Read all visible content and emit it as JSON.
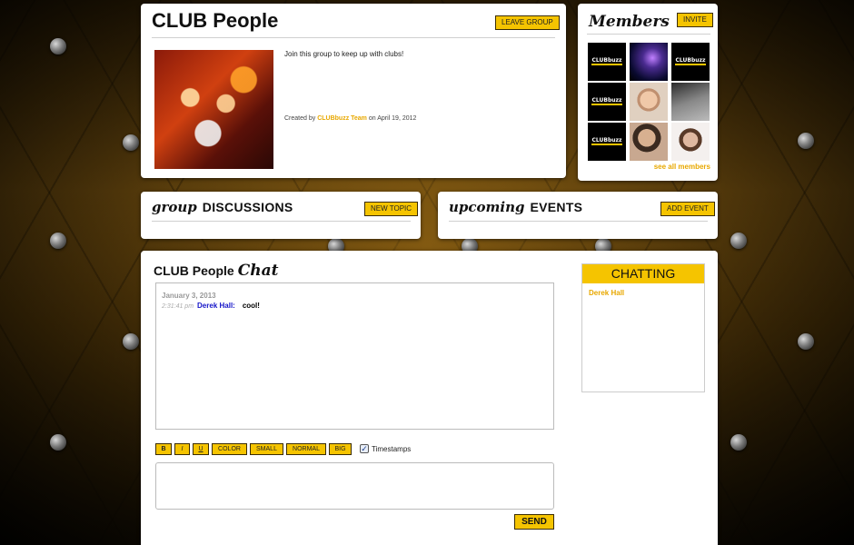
{
  "group": {
    "title": "CLUB People",
    "leave_label": "LEAVE GROUP",
    "description": "Join this group to keep up with clubs!",
    "created_prefix": "Created by",
    "created_by": "CLUBbuzz Team",
    "created_suffix": "on April 19, 2012"
  },
  "members": {
    "title": "Members",
    "invite_label": "INVITE",
    "see_all_label": "see all members",
    "logo_text": "CLUBbuzz"
  },
  "discussions": {
    "script": "group",
    "caps": "DISCUSSIONS",
    "button_label": "NEW TOPIC"
  },
  "events": {
    "script": "upcoming",
    "caps": "EVENTS",
    "button_label": "ADD EVENT"
  },
  "chat": {
    "title_caps": "CLUB People",
    "title_script": "Chat",
    "date": "January 3, 2013",
    "message": {
      "time": "2:31:41 pm",
      "user": "Derek Hall:",
      "text": "cool!"
    },
    "format_buttons": {
      "bold": "B",
      "italic": "I",
      "underline": "U",
      "color": "COLOR",
      "small": "SMALL",
      "normal": "NORMAL",
      "big": "BIG"
    },
    "timestamps_label": "Timestamps",
    "timestamps_checked": true,
    "send_label": "SEND",
    "chatting_header": "CHATTING",
    "chatting_users": [
      "Derek Hall"
    ]
  },
  "colors": {
    "accent": "#f5c400",
    "link": "#e8a800",
    "chat_user": "#1515c8"
  }
}
